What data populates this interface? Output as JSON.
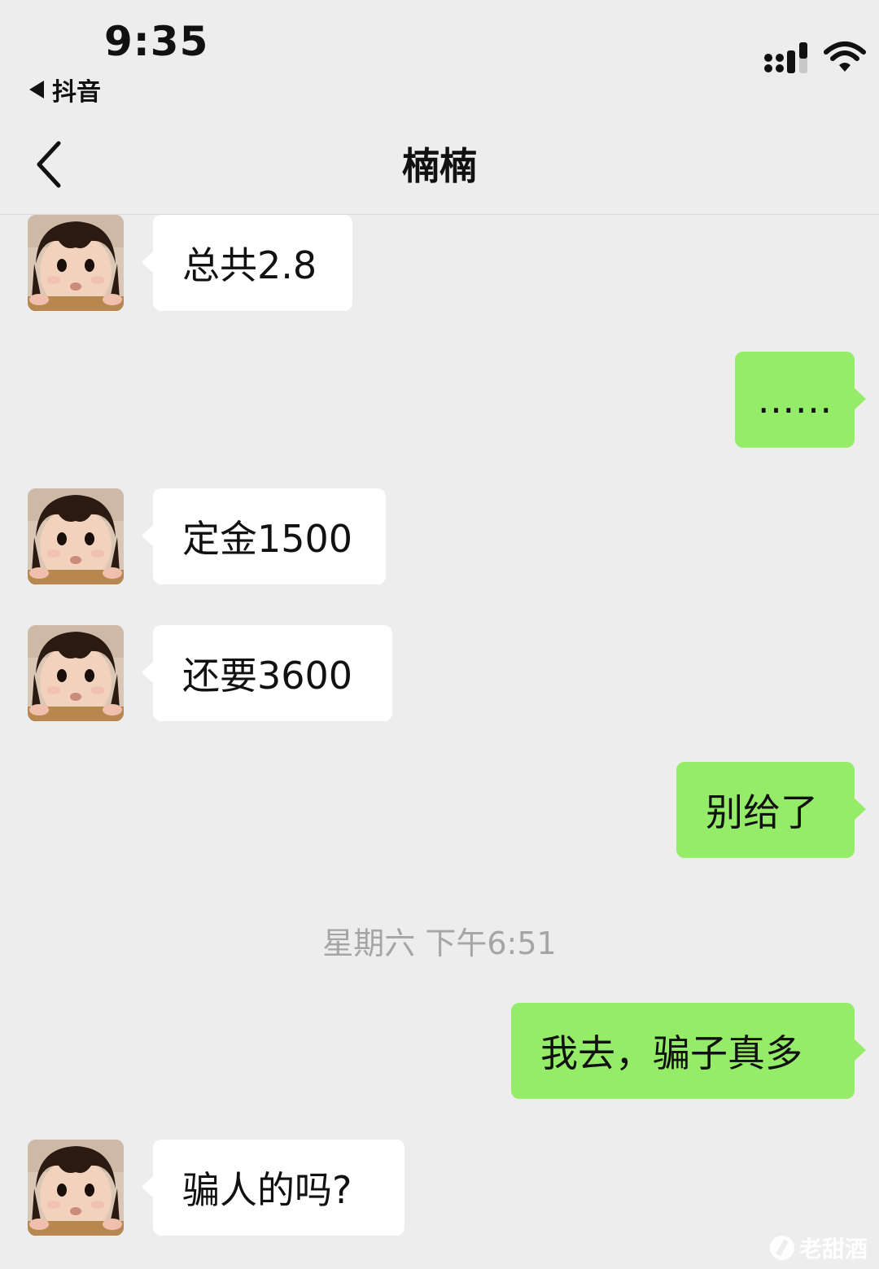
{
  "status_bar": {
    "time": "9:35",
    "back_app_label": "抖音",
    "signal_icon": "signal-bars-icon",
    "wifi_icon": "wifi-icon"
  },
  "nav": {
    "title": "楠楠",
    "back_icon": "chevron-left-icon"
  },
  "messages": [
    {
      "side": "left",
      "text": "总共2.8"
    },
    {
      "side": "right",
      "text": "……"
    },
    {
      "side": "left",
      "text": "定金1500"
    },
    {
      "side": "left",
      "text": "还要3600"
    },
    {
      "side": "right",
      "text": "别给了"
    },
    {
      "side": "right",
      "text": "我去，骗子真多"
    },
    {
      "side": "left",
      "text": "骗人的吗?"
    }
  ],
  "timestamp": "星期六 下午6:51",
  "watermark": "老甜酒",
  "colors": {
    "background": "#ededed",
    "self_bubble": "#95ec69",
    "other_bubble": "#ffffff",
    "timestamp_text": "#a5a5a5"
  }
}
